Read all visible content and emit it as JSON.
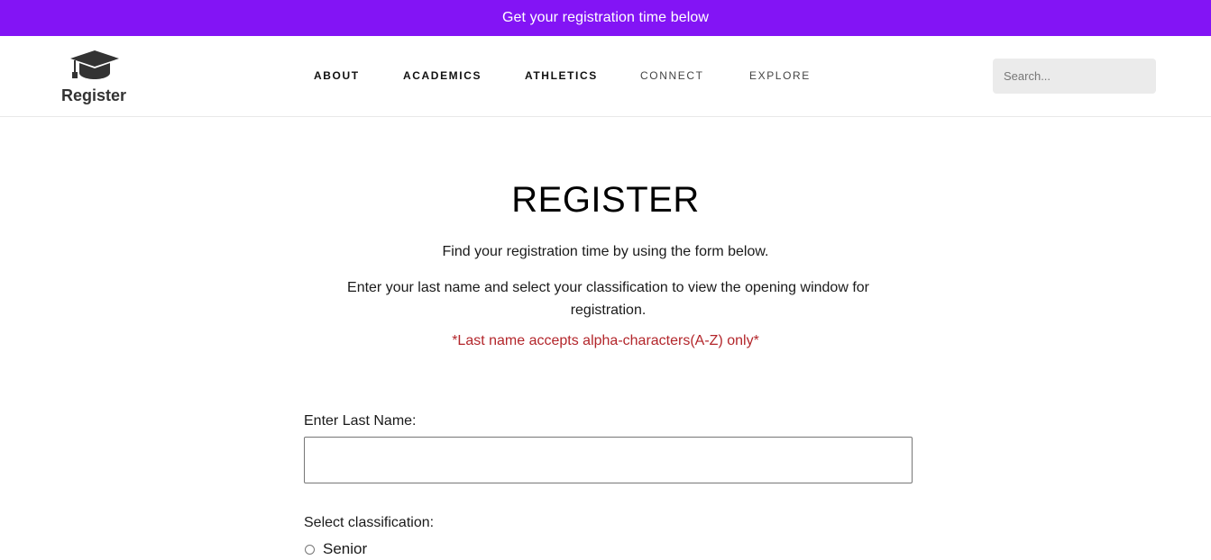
{
  "banner": {
    "text": "Get your registration time below",
    "color": "#8314f5"
  },
  "header": {
    "logo": {
      "icon": "graduation-cap-icon",
      "text": "Register"
    },
    "nav": [
      {
        "label": "ABOUT"
      },
      {
        "label": "ACADEMICS"
      },
      {
        "label": "ATHLETICS"
      },
      {
        "label": "CONNECT"
      },
      {
        "label": "EXPLORE"
      }
    ],
    "search": {
      "placeholder": "Search...",
      "value": ""
    }
  },
  "main": {
    "title": "REGISTER",
    "intro": "Find your registration time by using the form below.",
    "instructions": "Enter your last name and select your classification to view the opening window for registration.",
    "warning": "*Last name accepts alpha-characters(A-Z) only*",
    "warning_color": "#b3262b",
    "form": {
      "last_name_label": "Enter Last Name:",
      "last_name_value": "",
      "classification_label": "Select classification:",
      "options": [
        {
          "label": "Senior",
          "checked": false
        }
      ]
    }
  }
}
